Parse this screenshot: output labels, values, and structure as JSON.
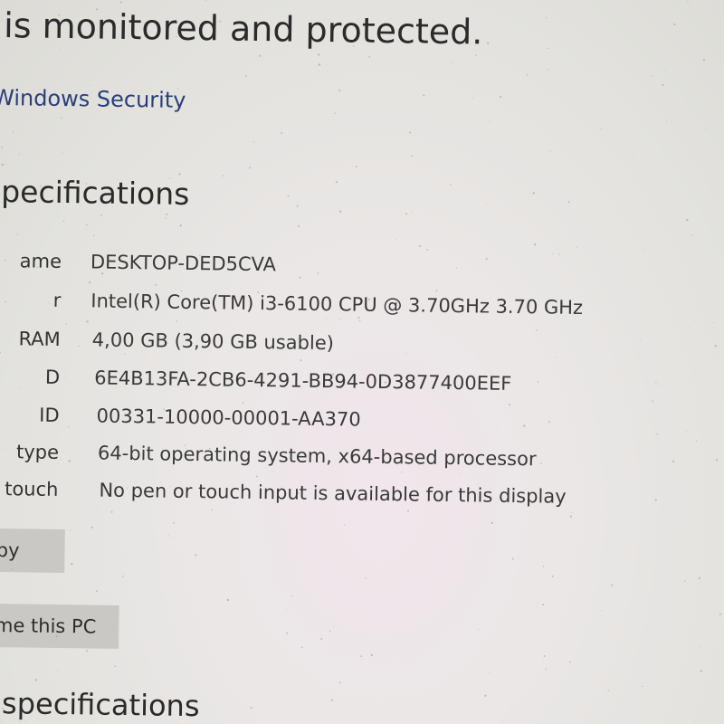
{
  "header": {
    "status_text": "C is monitored and protected.",
    "link_text": "s in Windows Security"
  },
  "device_specs": {
    "title": "specifications",
    "rows": [
      {
        "label": "ame",
        "value": "DESKTOP-DED5CVA"
      },
      {
        "label": "r",
        "value": "Intel(R) Core(TM) i3-6100 CPU @ 3.70GHz   3.70 GHz"
      },
      {
        "label": "RAM",
        "value": "4,00 GB (3,90 GB usable)"
      },
      {
        "label": "D",
        "value": "6E4B13FA-2CB6-4291-BB94-0D3877400EEF"
      },
      {
        "label": "ID",
        "value": "00331-10000-00001-AA370"
      },
      {
        "label": "type",
        "value": "64-bit operating system, x64-based processor"
      },
      {
        "label": "d touch",
        "value": "No pen or touch input is available for this display"
      }
    ]
  },
  "buttons": {
    "copy_label": "opy",
    "rename_label": "ame this PC"
  },
  "windows_specs": {
    "title": "dows specifications"
  }
}
